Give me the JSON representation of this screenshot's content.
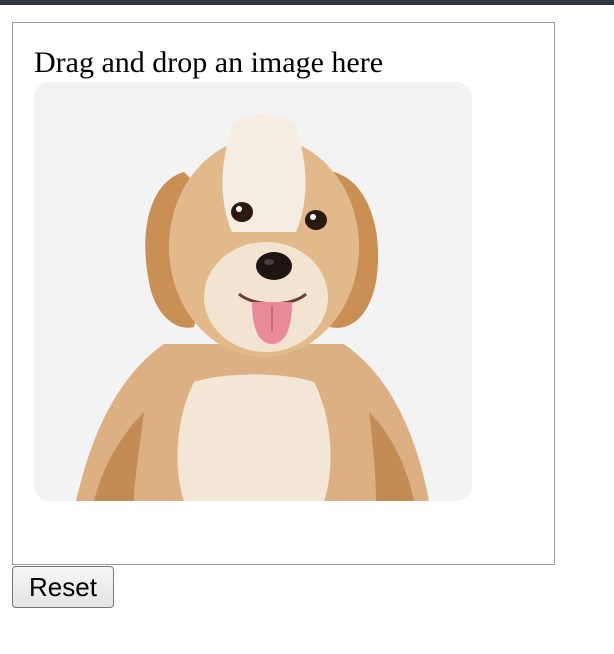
{
  "drop_zone": {
    "label": "Drag and drop an image here"
  },
  "dropped_image": {
    "subject": "puppy",
    "alt": "Fluffy tan and white puppy sitting with tongue out"
  },
  "controls": {
    "reset_label": "Reset"
  },
  "colors": {
    "top_bar": "#2f3742",
    "drop_zone_border": "#9a9a9a",
    "image_background": "#f3f3f3",
    "fur_main": "#d9ad7c",
    "fur_light": "#f5e8d8",
    "fur_dark": "#b27a44"
  }
}
